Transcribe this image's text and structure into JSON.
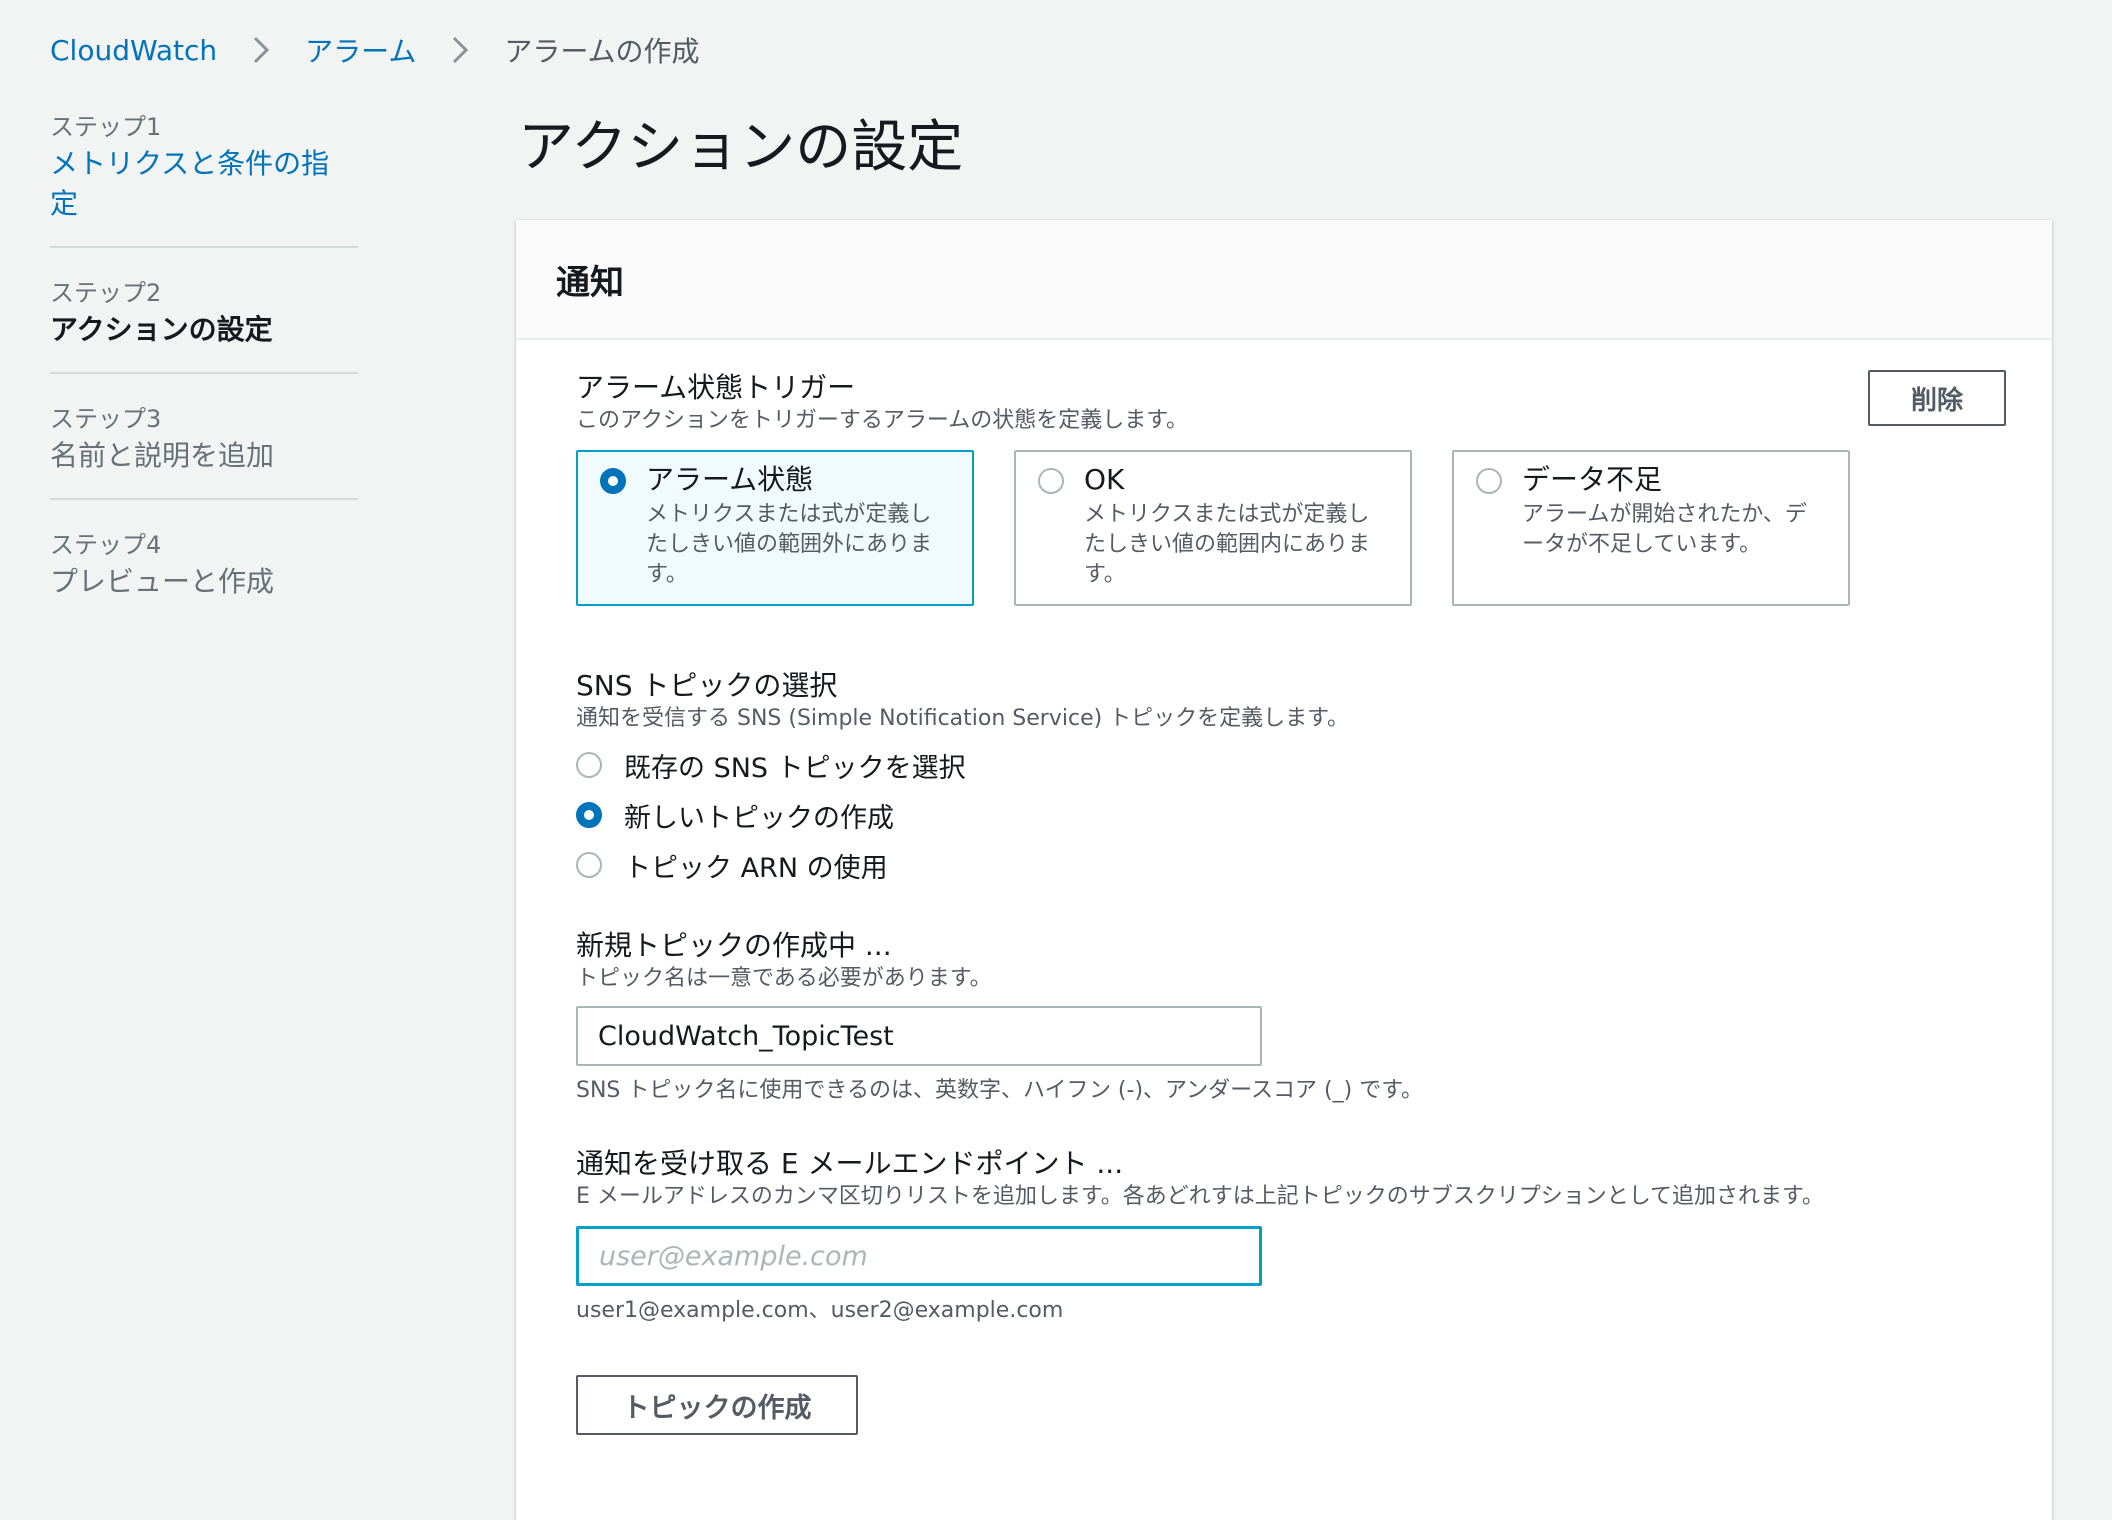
{
  "breadcrumb": {
    "items": [
      "CloudWatch",
      "アラーム",
      "アラームの作成"
    ]
  },
  "steps": [
    {
      "label": "ステップ1",
      "title": "メトリクスと条件の指定"
    },
    {
      "label": "ステップ2",
      "title": "アクションの設定"
    },
    {
      "label": "ステップ3",
      "title": "名前と説明を追加"
    },
    {
      "label": "ステップ4",
      "title": "プレビューと作成"
    }
  ],
  "page": {
    "title": "アクションの設定"
  },
  "panel": {
    "title": "通知",
    "trigger": {
      "label": "アラーム状態トリガー",
      "description": "このアクションをトリガーするアラームの状態を定義します。",
      "delete_label": "削除",
      "options": [
        {
          "title": "アラーム状態",
          "description": "メトリクスまたは式が定義したしきい値の範囲外にあります。",
          "selected": true
        },
        {
          "title": "OK",
          "description": "メトリクスまたは式が定義したしきい値の範囲内にあります。",
          "selected": false
        },
        {
          "title": "データ不足",
          "description": "アラームが開始されたか、データが不足しています。",
          "selected": false
        }
      ]
    },
    "sns": {
      "label": "SNS トピックの選択",
      "description": "通知を受信する SNS (Simple Notification Service) トピックを定義します。",
      "options": [
        {
          "label": "既存の SNS トピックを選択",
          "selected": false
        },
        {
          "label": "新しいトピックの作成",
          "selected": true
        },
        {
          "label": "トピック ARN の使用",
          "selected": false
        }
      ]
    },
    "new_topic": {
      "label": "新規トピックの作成中 ...",
      "description": "トピック名は一意である必要があります。",
      "value": "CloudWatch_TopicTest",
      "constraint": "SNS トピック名に使用できるのは、英数字、ハイフン (-)、アンダースコア (_) です。"
    },
    "email": {
      "label": "通知を受け取る E メールエンドポイント ...",
      "description": "E メールアドレスのカンマ区切りリストを追加します。各あどれすは上記トピックのサブスクリプションとして追加されます。",
      "placeholder": "user@example.com",
      "value": "",
      "example": "user1@example.com、user2@example.com"
    },
    "create_button_label": "トピックの作成"
  }
}
